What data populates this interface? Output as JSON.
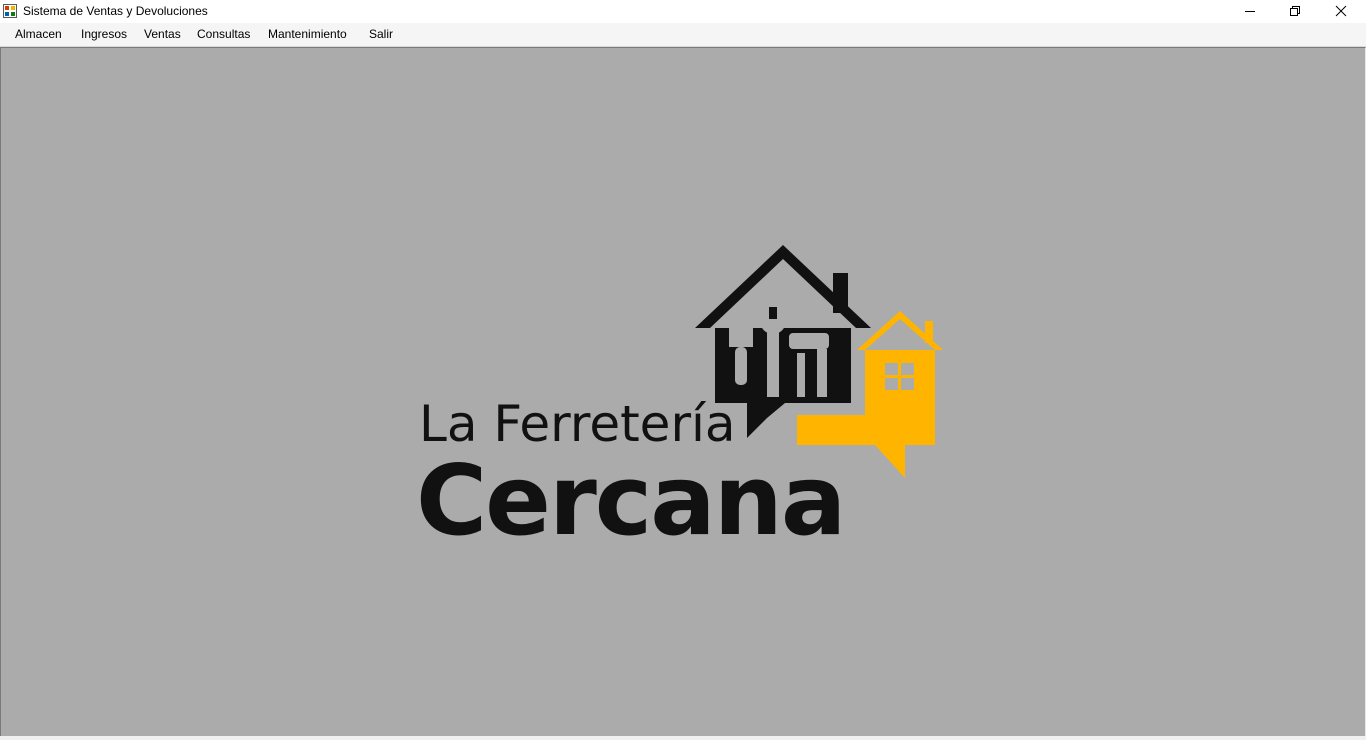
{
  "window": {
    "title": "Sistema de Ventas y Devoluciones",
    "app_icon": "form-icon",
    "controls": {
      "minimize_icon": "minimize-icon",
      "restore_icon": "restore-icon",
      "close_icon": "close-icon"
    }
  },
  "menubar": {
    "items": [
      {
        "label": "Almacen"
      },
      {
        "label": "Ingresos"
      },
      {
        "label": "Ventas"
      },
      {
        "label": "Consultas"
      },
      {
        "label": "Mantenimiento"
      },
      {
        "label": "Salir"
      }
    ]
  },
  "client": {
    "background": "#ababab",
    "logo": {
      "line1": "La Ferretería",
      "line2": "Cercana",
      "colors": {
        "dark": "#111111",
        "accent": "#ffb400"
      }
    }
  }
}
